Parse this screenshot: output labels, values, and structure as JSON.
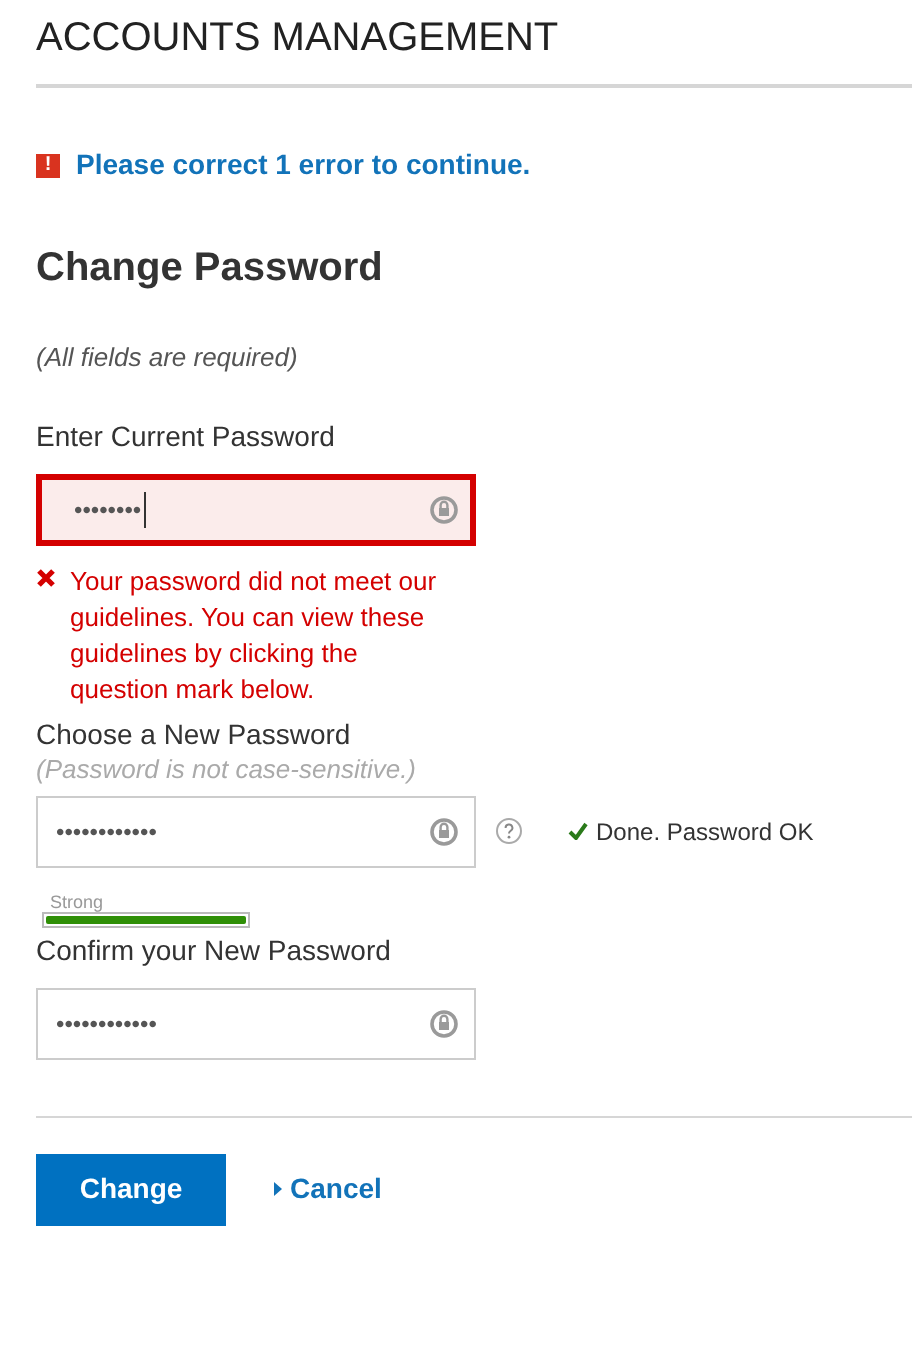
{
  "header": {
    "title": "ACCOUNTS MANAGEMENT"
  },
  "error_summary": {
    "icon": "!",
    "text": "Please correct 1 error to continue."
  },
  "form": {
    "title": "Change Password",
    "note": "(All fields are required)",
    "fields": [
      {
        "label": "Enter Current Password",
        "value": "••••••••",
        "invalid": true,
        "focused": true,
        "error": "Your password did not meet our guidelines. You can view these guidelines by clicking the question mark below."
      },
      {
        "label": "Choose a New Password",
        "hint": "(Password is not case-sensitive.)",
        "value": "••••••••••••",
        "invalid": false,
        "focused": false,
        "status": "Done. Password OK",
        "strength": {
          "label": "Strong",
          "level": 1
        }
      },
      {
        "label": "Confirm your New Password",
        "value": "••••••••••••",
        "invalid": false,
        "focused": false
      }
    ]
  },
  "buttons": {
    "primary": "Change",
    "cancel": "Cancel"
  }
}
